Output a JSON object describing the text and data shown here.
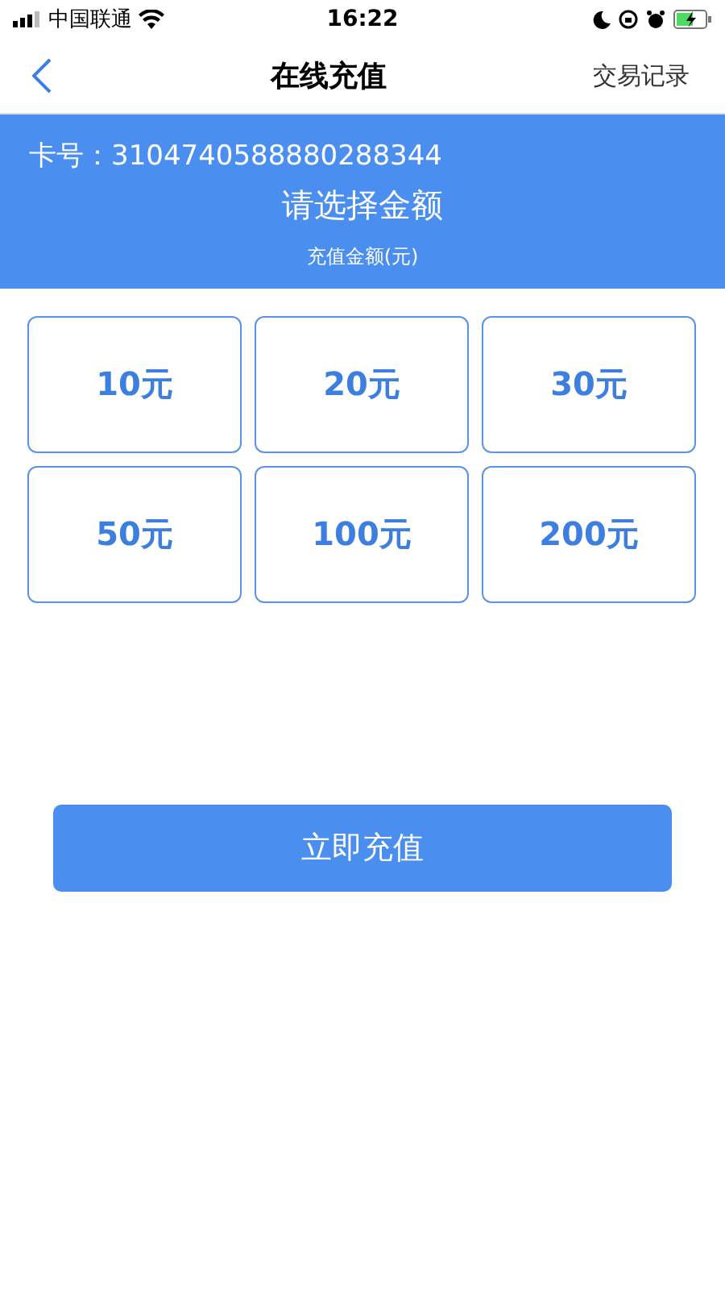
{
  "status_bar": {
    "carrier": "中国联通",
    "time": "16:22"
  },
  "nav": {
    "title": "在线充值",
    "action": "交易记录"
  },
  "header": {
    "card_label": "卡号：",
    "card_number": "3104740588880288344",
    "prompt": "请选择金额",
    "caption": "充值金额(元)"
  },
  "amounts": [
    "10元",
    "20元",
    "30元",
    "50元",
    "100元",
    "200元"
  ],
  "submit": "立即充值"
}
